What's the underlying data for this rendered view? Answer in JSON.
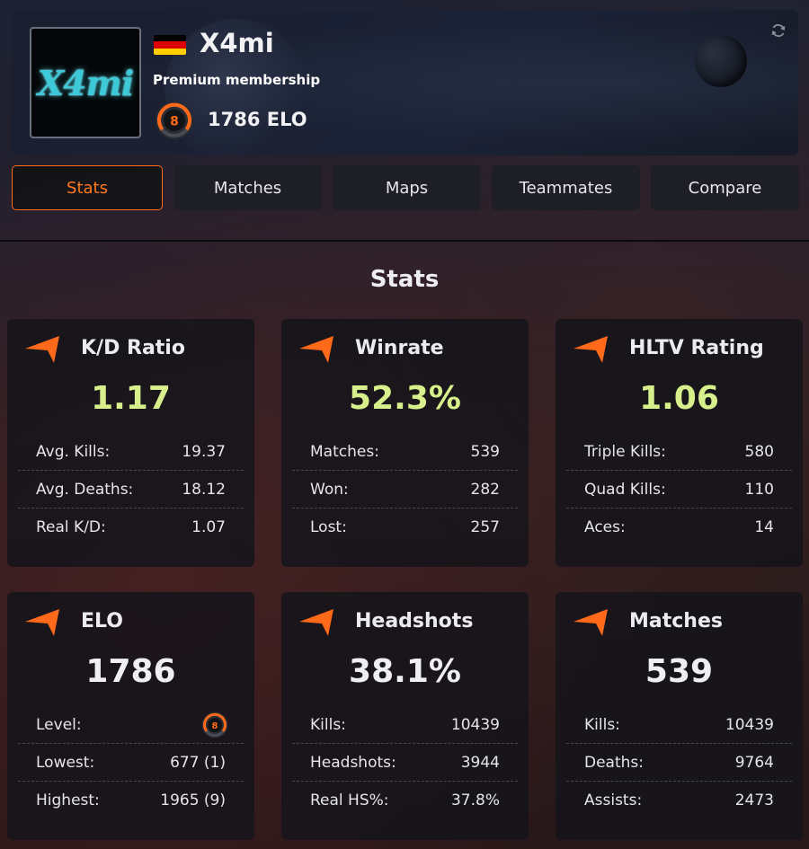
{
  "profile": {
    "avatar_text": "X4mi",
    "username": "X4mi",
    "membership": "Premium membership",
    "level": "8",
    "elo_label": "1786 ELO",
    "flag_colors": [
      "#000000",
      "#dd0000",
      "#ffce00"
    ]
  },
  "icons": {
    "refresh": "refresh-icon",
    "card": "orange-arrow-icon",
    "level": "level-badge-icon"
  },
  "colors": {
    "accent": "#ff6a1a",
    "highlight_value": "#d8f08c",
    "level_ring": "#ff6a1a"
  },
  "tabs": [
    {
      "label": "Stats",
      "active": true
    },
    {
      "label": "Matches",
      "active": false
    },
    {
      "label": "Maps",
      "active": false
    },
    {
      "label": "Teammates",
      "active": false
    },
    {
      "label": "Compare",
      "active": false
    }
  ],
  "section_title": "Stats",
  "cards": [
    {
      "title": "K/D Ratio",
      "value": "1.17",
      "rows": [
        {
          "label": "Avg. Kills:",
          "value": "19.37"
        },
        {
          "label": "Avg. Deaths:",
          "value": "18.12"
        },
        {
          "label": "Real K/D:",
          "value": "1.07"
        }
      ]
    },
    {
      "title": "Winrate",
      "value": "52.3%",
      "rows": [
        {
          "label": "Matches:",
          "value": "539"
        },
        {
          "label": "Won:",
          "value": "282"
        },
        {
          "label": "Lost:",
          "value": "257"
        }
      ]
    },
    {
      "title": "HLTV Rating",
      "value": "1.06",
      "rows": [
        {
          "label": "Triple Kills:",
          "value": "580"
        },
        {
          "label": "Quad Kills:",
          "value": "110"
        },
        {
          "label": "Aces:",
          "value": "14"
        }
      ]
    },
    {
      "title": "ELO",
      "value": "1786",
      "rows": [
        {
          "label": "Level:",
          "value": "8"
        },
        {
          "label": "Lowest:",
          "value": "677 (1)"
        },
        {
          "label": "Highest:",
          "value": "1965 (9)"
        }
      ]
    },
    {
      "title": "Headshots",
      "value": "38.1%",
      "rows": [
        {
          "label": "Kills:",
          "value": "10439"
        },
        {
          "label": "Headshots:",
          "value": "3944"
        },
        {
          "label": "Real HS%:",
          "value": "37.8%"
        }
      ]
    },
    {
      "title": "Matches",
      "value": "539",
      "rows": [
        {
          "label": "Kills:",
          "value": "10439"
        },
        {
          "label": "Deaths:",
          "value": "9764"
        },
        {
          "label": "Assists:",
          "value": "2473"
        }
      ]
    }
  ]
}
